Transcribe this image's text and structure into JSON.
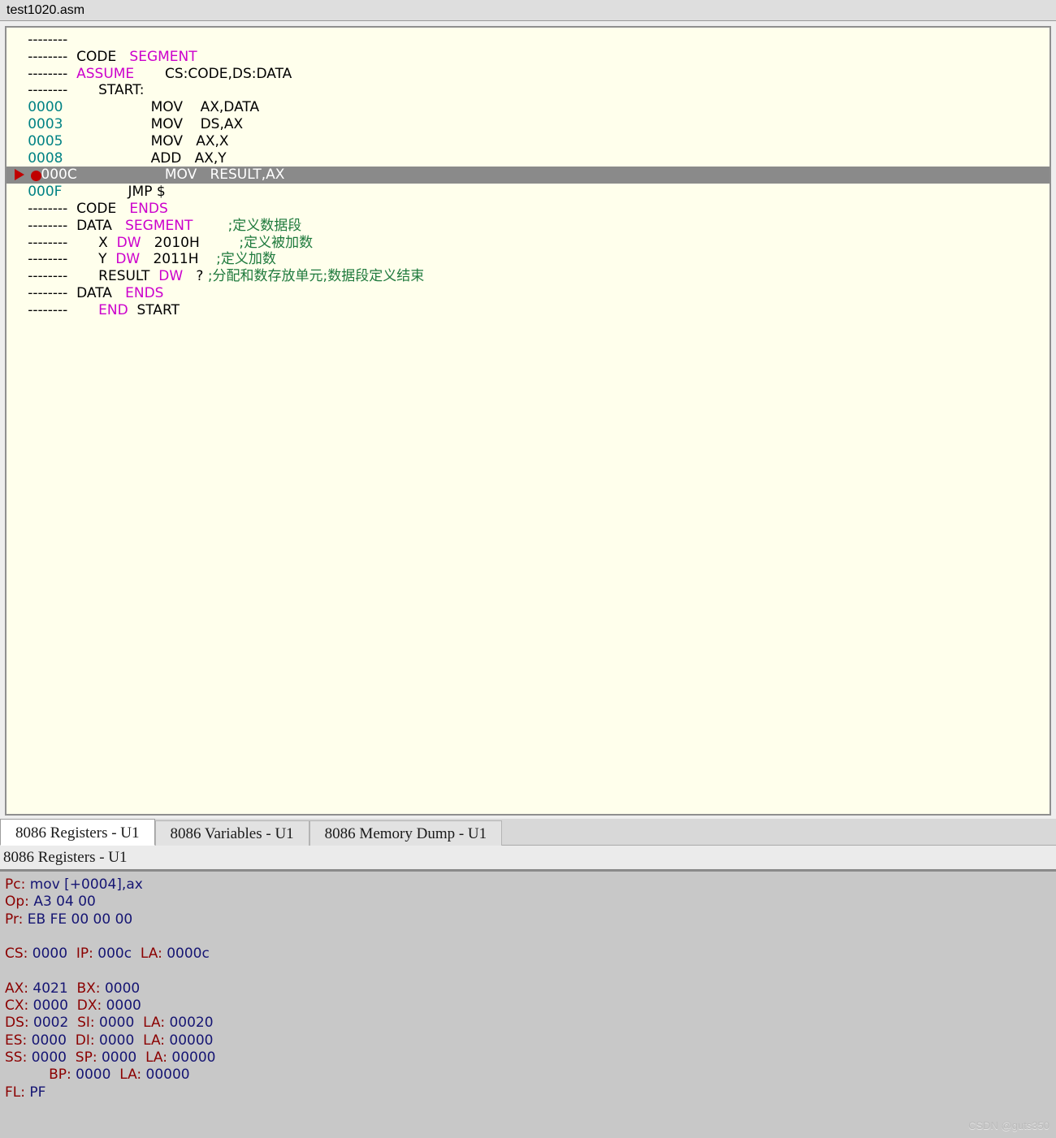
{
  "window": {
    "file_tab_label": "test1020.asm"
  },
  "colors": {
    "editor_bg": "#ffffec",
    "address": "#008284",
    "directive": "#cc00cc",
    "comment": "#1f7a3d",
    "current_line_bg": "#8a8a8a",
    "marker_red": "#c00000",
    "reg_label": "#8b0000",
    "reg_value": "#151573"
  },
  "editor": {
    "dash_placeholder": "--------",
    "lines": [
      {
        "addr": "--------",
        "is_dash": true,
        "current": false,
        "text": ""
      },
      {
        "addr": "--------",
        "is_dash": true,
        "current": false,
        "text": "CODE   SEGMENT"
      },
      {
        "addr": "--------",
        "is_dash": true,
        "current": false,
        "text": "ASSUME       CS:CODE,DS:DATA"
      },
      {
        "addr": "--------",
        "is_dash": true,
        "current": false,
        "text": "     START:"
      },
      {
        "addr": "0000",
        "is_dash": false,
        "current": false,
        "text": "              MOV    AX,DATA"
      },
      {
        "addr": "0003",
        "is_dash": false,
        "current": false,
        "text": "              MOV    DS,AX"
      },
      {
        "addr": "0005",
        "is_dash": false,
        "current": false,
        "text": "              MOV   AX,X"
      },
      {
        "addr": "0008",
        "is_dash": false,
        "current": false,
        "text": "              ADD   AX,Y"
      },
      {
        "addr": "000C",
        "is_dash": false,
        "current": true,
        "text": "              MOV   RESULT,AX"
      },
      {
        "addr": "000F",
        "is_dash": false,
        "current": false,
        "text": "         JMP $"
      },
      {
        "addr": "--------",
        "is_dash": true,
        "current": false,
        "text": "CODE   ENDS"
      },
      {
        "addr": "--------",
        "is_dash": true,
        "current": false,
        "text": "DATA   SEGMENT        ;定义数据段"
      },
      {
        "addr": "--------",
        "is_dash": true,
        "current": false,
        "text": "     X  DW   2010H         ;定义被加数"
      },
      {
        "addr": "--------",
        "is_dash": true,
        "current": false,
        "text": "     Y  DW   2011H    ;定义加数"
      },
      {
        "addr": "--------",
        "is_dash": true,
        "current": false,
        "text": "     RESULT  DW   ? ;分配和数存放单元;数据段定义结束"
      },
      {
        "addr": "--------",
        "is_dash": true,
        "current": false,
        "text": "DATA   ENDS"
      },
      {
        "addr": "--------",
        "is_dash": true,
        "current": false,
        "text": "     END  START"
      }
    ],
    "tokens": {
      "line1": [
        {
          "t": "CODE",
          "c": "ident"
        },
        {
          "t": "   "
        },
        {
          "t": "SEGMENT",
          "c": "dir"
        }
      ],
      "line2": [
        {
          "t": "ASSUME",
          "c": "dir"
        },
        {
          "t": "        "
        },
        {
          "t": "CS:CODE,DS:DATA",
          "c": "ident"
        }
      ]
    },
    "markers": {
      "current_arrow": "play-arrow-icon",
      "breakpoint": "breakpoint-icon"
    }
  },
  "tabs": [
    {
      "label": "8086 Registers - U1",
      "active": true
    },
    {
      "label": "8086 Variables - U1",
      "active": false
    },
    {
      "label": "8086 Memory Dump - U1",
      "active": false
    }
  ],
  "panel": {
    "caption": "8086 Registers - U1",
    "rows": [
      {
        "type": "pair",
        "cells": [
          {
            "label": "Pc:",
            "value": "mov [+0004],ax"
          }
        ]
      },
      {
        "type": "pair",
        "cells": [
          {
            "label": "Op:",
            "value": "A3 04 00"
          }
        ]
      },
      {
        "type": "pair",
        "cells": [
          {
            "label": "Pr:",
            "value": "EB FE 00 00 00"
          }
        ]
      },
      {
        "type": "spacer"
      },
      {
        "type": "pair",
        "cells": [
          {
            "label": "CS:",
            "value": "0000"
          },
          {
            "label": "IP:",
            "value": "000c"
          },
          {
            "label": "LA:",
            "value": "0000c"
          }
        ]
      },
      {
        "type": "spacer"
      },
      {
        "type": "pair",
        "cells": [
          {
            "label": "AX:",
            "value": "4021"
          },
          {
            "label": "BX:",
            "value": "0000"
          }
        ]
      },
      {
        "type": "pair",
        "cells": [
          {
            "label": "CX:",
            "value": "0000"
          },
          {
            "label": "DX:",
            "value": "0000"
          }
        ]
      },
      {
        "type": "pair",
        "cells": [
          {
            "label": "DS:",
            "value": "0002"
          },
          {
            "label": "SI:",
            "value": "0000"
          },
          {
            "label": "LA:",
            "value": "00020"
          }
        ]
      },
      {
        "type": "pair",
        "cells": [
          {
            "label": "ES:",
            "value": "0000"
          },
          {
            "label": "DI:",
            "value": "0000"
          },
          {
            "label": "LA:",
            "value": "00000"
          }
        ]
      },
      {
        "type": "pair",
        "cells": [
          {
            "label": "SS:",
            "value": "0000"
          },
          {
            "label": "SP:",
            "value": "0000"
          },
          {
            "label": "LA:",
            "value": "00000"
          }
        ]
      },
      {
        "type": "pair",
        "cells": [
          {
            "label": "",
            "value": ""
          },
          {
            "label": "BP:",
            "value": "0000"
          },
          {
            "label": "LA:",
            "value": "00000"
          }
        ]
      },
      {
        "type": "pair",
        "cells": [
          {
            "label": "FL:",
            "value": "PF"
          }
        ]
      }
    ]
  },
  "watermark": "CSDN @guts350"
}
